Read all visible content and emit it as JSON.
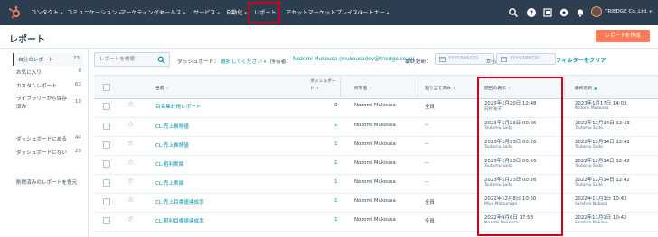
{
  "nav": {
    "items": [
      "コンタクト",
      "コミュニケーション",
      "マーケティング",
      "セールス",
      "サービス",
      "自動化",
      "レポート",
      "アセットマーケットプレイス",
      "パートナー"
    ],
    "brand": "TRIEDGE Co.,Ltd."
  },
  "header": {
    "title": "レポート",
    "create_button": "レポートを作成"
  },
  "sidebar": {
    "items": [
      {
        "label": "自分のレポート",
        "count": "73"
      },
      {
        "label": "お気に入り",
        "count": "0"
      },
      {
        "label": "カスタムレポート",
        "count": "63"
      },
      {
        "label": "ライブラリーから保存済み",
        "count": "10"
      },
      {
        "label": "ダッシュボードにある",
        "count": "44"
      },
      {
        "label": "ダッシュボードにない",
        "count": "29"
      }
    ],
    "restore_link": "削除済みのレポートを復元"
  },
  "filters": {
    "search_placeholder": "レポートを検索",
    "dashboard_label": "ダッシュボード：",
    "dashboard_value": "選択してください",
    "owner_label": "所有者：",
    "owner_value": "Nozomi Mukousa (mukousadev@triedge.co.jp)",
    "updated_label": "最終更新：",
    "date_placeholder": "YYYY/MM/DD",
    "from_to": "から",
    "clear_label": "フィルターをクリア"
  },
  "table": {
    "columns": [
      "名前",
      "ダッシュボード",
      "所有者",
      "割り当て済み",
      "前回の表示",
      "最終更新"
    ],
    "rows": [
      {
        "name": "目名集計用レポート",
        "dashboards": "0",
        "owner": "Nozomi Mukousa",
        "assigned": "全員",
        "last_viewed": "2023年1月20日 12:48",
        "last_viewed_by": "向村 祐子",
        "updated": "2023年1月17日 14:03",
        "updated_by": "Nozomi Mukousa"
      },
      {
        "name": "CL:売上推移値",
        "dashboards": "1",
        "owner": "Nozomi Mukousa",
        "assigned": "--",
        "last_viewed": "2023年1月23日 00:26",
        "last_viewed_by": "Tsutomu Saito",
        "updated": "2022年12月14日 12:43",
        "updated_by": "Tsutomu Saito"
      },
      {
        "name": "CL:売上推移値",
        "dashboards": "1",
        "owner": "Nozomi Mukousa",
        "assigned": "--",
        "last_viewed": "2023年1月23日 00:26",
        "last_viewed_by": "Tsutomu Saito",
        "updated": "2022年12月14日 12:42",
        "updated_by": "Tsutomu Saito"
      },
      {
        "name": "CL:粗利実績",
        "dashboards": "1",
        "owner": "Nozomi Mukousa",
        "assigned": "--",
        "last_viewed": "2023年1月23日 00:26",
        "last_viewed_by": "Tsutomu Saito",
        "updated": "2022年12月14日 12:42",
        "updated_by": "Tsutomu Saito"
      },
      {
        "name": "CL:売上実績",
        "dashboards": "1",
        "owner": "Nozomi Mukousa",
        "assigned": "--",
        "last_viewed": "2023年1月23日 00:26",
        "last_viewed_by": "Tsutomu Saito",
        "updated": "2022年12月14日 12:42",
        "updated_by": "Tsutomu Saito"
      },
      {
        "name": "CL:売上目標値達成率",
        "dashboards": "1",
        "owner": "Nozomi Mukousa",
        "assigned": "全員",
        "last_viewed": "2022年12月8日 10:50",
        "last_viewed_by": "Miyu Matsunaga",
        "updated": "2022年11月1日 10:43",
        "updated_by": "Sarahiro Nakano"
      },
      {
        "name": "CL:粗利目標値達成率",
        "dashboards": "1",
        "owner": "Nozomi Mukousa",
        "assigned": "全員",
        "last_viewed": "2022年9月6日 17:58",
        "last_viewed_by": "Nozomi Mukousa",
        "updated": "2022年11月1日 10:42",
        "updated_by": "Sarahiro Nakano"
      }
    ]
  },
  "colors": {
    "nav_bg": "#2d3e50",
    "accent": "#ff7a59",
    "link": "#0091ae",
    "highlight": "#d0021b"
  }
}
